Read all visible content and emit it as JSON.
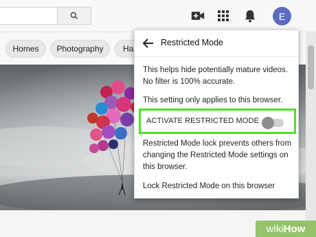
{
  "header": {
    "avatar_letter": "E",
    "icons": [
      "search-icon",
      "video-camera-plus-icon",
      "apps-grid-icon",
      "bell-icon"
    ]
  },
  "chips": [
    {
      "label": "Homes"
    },
    {
      "label": "Photography"
    },
    {
      "label": "Hai"
    }
  ],
  "restricted_panel": {
    "title": "Restricted Mode",
    "description_1": "This helps hide potentially mature videos.",
    "description_2": "No filter is 100% accurate.",
    "browser_note": "This setting only applies to this browser.",
    "toggle_label": "ACTIVATE RESTRICTED MODE",
    "toggle_state": "off",
    "lock_info_1": "Restricted Mode lock prevents others from",
    "lock_info_2": "changing the Restricted Mode settings on",
    "lock_info_3": "this browser.",
    "lock_link": "Lock Restricted Mode on this browser"
  },
  "watermark": {
    "prefix": "wiki",
    "suffix": "How"
  },
  "colors": {
    "avatar": "#5c6bc0",
    "highlight": "#4ee02a",
    "watermark": "#95c26b"
  }
}
